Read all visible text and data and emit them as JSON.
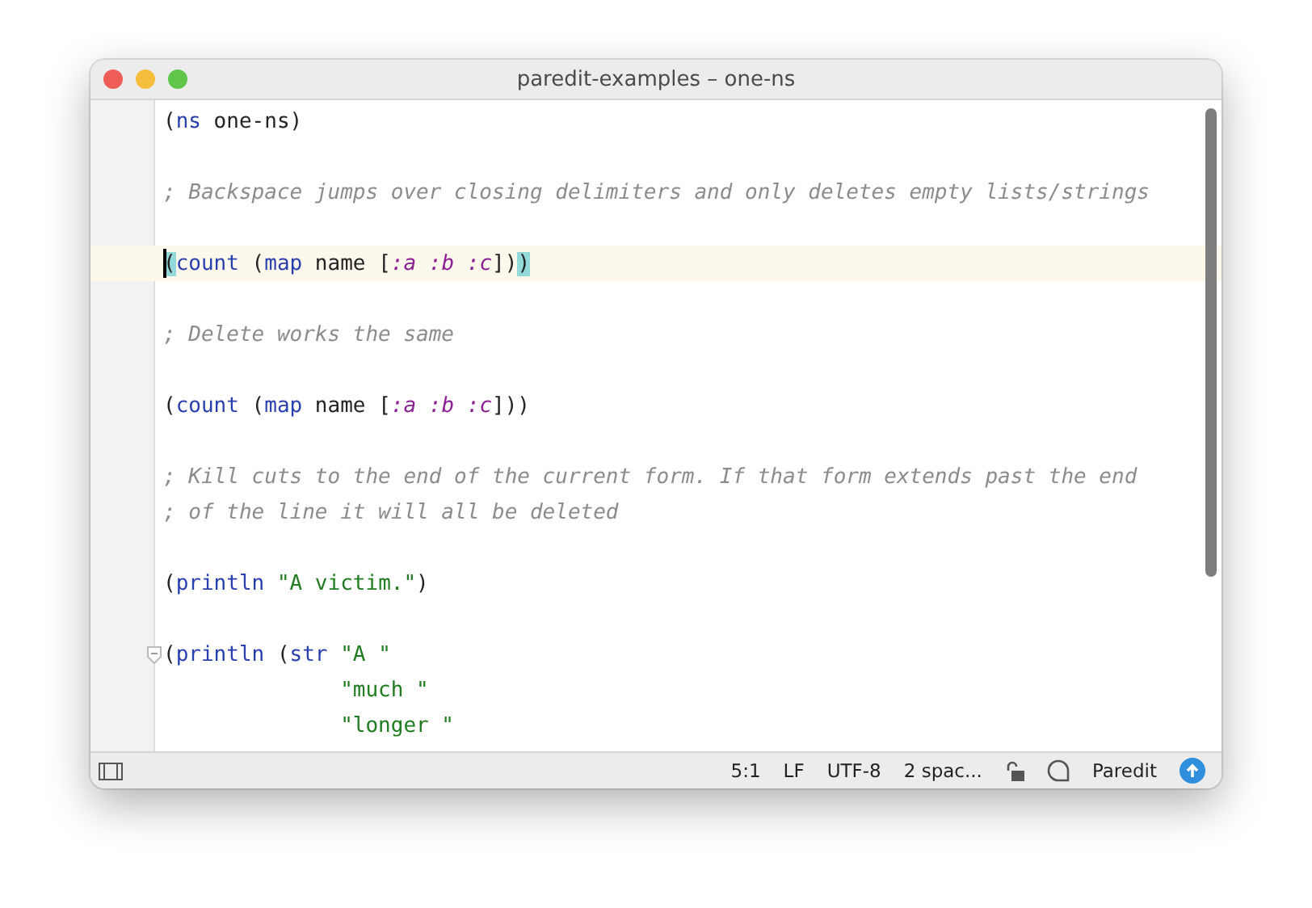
{
  "window": {
    "title": "paredit-examples – one-ns"
  },
  "editor": {
    "lines": [
      {
        "current": false,
        "fold": false,
        "continuation": false,
        "tokens": [
          {
            "kind": "paren",
            "text": "("
          },
          {
            "kind": "keyword",
            "text": "ns"
          },
          {
            "kind": "symbol",
            "text": " one-ns"
          },
          {
            "kind": "paren",
            "text": ")"
          }
        ]
      },
      {
        "current": false,
        "fold": false,
        "continuation": false
      },
      {
        "current": false,
        "fold": false,
        "continuation": false,
        "tokens": [
          {
            "kind": "comment",
            "text": "; Backspace jumps over closing delimiters and only deletes empty lists/strings"
          }
        ]
      },
      {
        "current": false,
        "fold": false,
        "continuation": false
      },
      {
        "current": true,
        "fold": false,
        "continuation": false,
        "tokens": [
          {
            "kind": "paren",
            "text": "(",
            "matched": true
          },
          {
            "kind": "keyword",
            "text": "count"
          },
          {
            "kind": "symbol",
            "text": " ("
          },
          {
            "kind": "keyword",
            "text": "map"
          },
          {
            "kind": "symbol",
            "text": " name ["
          },
          {
            "kind": "kwarg",
            "text": ":a :b :c"
          },
          {
            "kind": "symbol",
            "text": "])"
          },
          {
            "kind": "paren",
            "text": ")",
            "matched": true
          }
        ]
      },
      {
        "current": false,
        "fold": false,
        "continuation": false
      },
      {
        "current": false,
        "fold": false,
        "continuation": false,
        "tokens": [
          {
            "kind": "comment",
            "text": "; Delete works the same"
          }
        ]
      },
      {
        "current": false,
        "fold": false,
        "continuation": false
      },
      {
        "current": false,
        "fold": false,
        "continuation": false,
        "tokens": [
          {
            "kind": "paren",
            "text": "("
          },
          {
            "kind": "keyword",
            "text": "count"
          },
          {
            "kind": "symbol",
            "text": " ("
          },
          {
            "kind": "keyword",
            "text": "map"
          },
          {
            "kind": "symbol",
            "text": " name ["
          },
          {
            "kind": "kwarg",
            "text": ":a :b :c"
          },
          {
            "kind": "symbol",
            "text": "]))"
          }
        ]
      },
      {
        "current": false,
        "fold": false,
        "continuation": false
      },
      {
        "current": false,
        "fold": false,
        "continuation": false,
        "tokens": [
          {
            "kind": "comment",
            "text": "; Kill cuts to the end of the current form. If that form extends past the end"
          }
        ]
      },
      {
        "current": false,
        "fold": false,
        "continuation": false,
        "tokens": [
          {
            "kind": "comment",
            "text": "; of the line it will all be deleted"
          }
        ]
      },
      {
        "current": false,
        "fold": false,
        "continuation": false
      },
      {
        "current": false,
        "fold": false,
        "continuation": false,
        "tokens": [
          {
            "kind": "paren",
            "text": "("
          },
          {
            "kind": "keyword",
            "text": "println"
          },
          {
            "kind": "string",
            "text": " \"A victim.\""
          },
          {
            "kind": "symbol",
            "text": ")"
          }
        ]
      },
      {
        "current": false,
        "fold": false,
        "continuation": false
      },
      {
        "current": false,
        "fold": true,
        "continuation": false,
        "tokens": [
          {
            "kind": "paren",
            "text": "("
          },
          {
            "kind": "keyword",
            "text": "println"
          },
          {
            "kind": "symbol",
            "text": " ("
          },
          {
            "kind": "keyword",
            "text": "str"
          },
          {
            "kind": "string",
            "text": " \"A \""
          }
        ]
      },
      {
        "current": false,
        "fold": false,
        "continuation": true,
        "tokens": [
          {
            "kind": "string",
            "text": "\"much \""
          }
        ]
      },
      {
        "current": false,
        "fold": false,
        "continuation": true,
        "tokens": [
          {
            "kind": "string",
            "text": "\"longer \""
          }
        ]
      }
    ]
  },
  "status_bar": {
    "position": "5:1",
    "line_separator": "LF",
    "encoding": "UTF-8",
    "indent": "2 spac...",
    "mode": "Paredit"
  }
}
